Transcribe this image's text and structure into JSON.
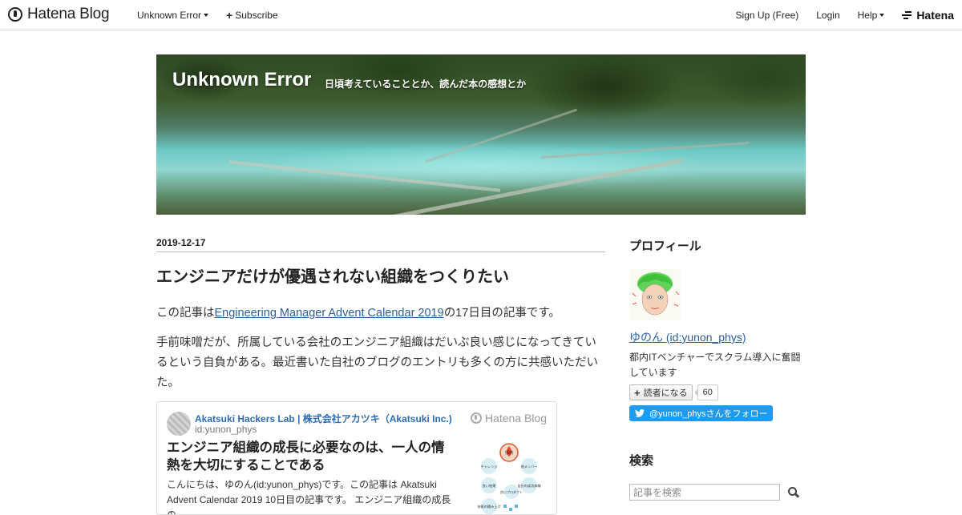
{
  "topbar": {
    "brand": "Hatena Blog",
    "blog_menu": "Unknown Error",
    "subscribe": "Subscribe",
    "signup": "Sign Up (Free)",
    "login": "Login",
    "help": "Help",
    "hatena": "Hatena"
  },
  "header": {
    "title": "Unknown Error",
    "description": "日頃考えていることとか、読んだ本の感想とか"
  },
  "entry": {
    "date": "2019-12-17",
    "title": "エンジニアだけが優遇されない組織をつくりたい",
    "p1_before": "この記事は",
    "p1_link": "Engineering Manager Advent Calendar 2019",
    "p1_after": "の17日目の記事です。",
    "p2": "手前味噌だが、所属している会社のエンジニア組織はだいぶ良い感じになってきているという自負がある。最近書いた自社のブログのエントリも多くの方に共感いただいた。"
  },
  "embed": {
    "site": "Akatsuki Hackers Lab | 株式会社アカツキ（Akatsuki Inc.)",
    "user": "id:yunon_phys",
    "brand": "Hatena Blog",
    "title": "エンジニア組織の成長に必要なのは、一人の情熱を大切にすることである",
    "snippet": "こんにちは、ゆのん(id:yunon_phys)です。この記事は Akatsuki Advent Calendar 2019 10日目の記事です。 エンジニア組織の成長の",
    "diagram_labels": [
      "情熱",
      "チャレンジ",
      "他メンバー",
      "良い結果",
      "自分の成功体験",
      "良いプロダクト",
      "技術の積み上げ"
    ]
  },
  "sidebar": {
    "profile_heading": "プロフィール",
    "profile_name": "ゆのん (id:yunon_phys)",
    "profile_desc": "都内ITベンチャーでスクラム導入に奮闘しています",
    "reader_button": "読者になる",
    "reader_count": "60",
    "twitter_follow": "@yunon_physさんをフォロー",
    "search_heading": "検索",
    "search_placeholder": "記事を検索"
  },
  "colors": {
    "link": "#2b5e9e",
    "embed_site": "#2b6cb5",
    "twitter": "#1d9bf0",
    "banner_water": "#6ccac6"
  }
}
